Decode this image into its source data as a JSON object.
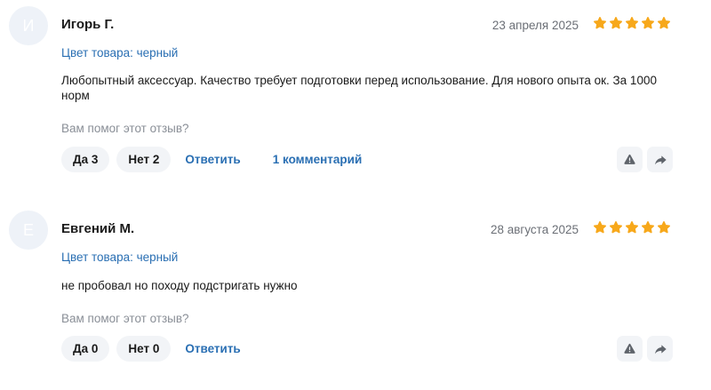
{
  "helpful_question": "Вам помог этот отзыв?",
  "reply_label": "Ответить",
  "colors": {
    "link": "#2a6fb3",
    "star": "#f7a81b",
    "pill_bg": "#f2f4f7",
    "avatar_bg": "#eef2f8"
  },
  "reviews": [
    {
      "avatar_letter": "И",
      "author": "Игорь Г.",
      "date": "23 апреля 2025",
      "rating": 5,
      "product_color": "Цвет товара: черный",
      "text": "Любопытный аксессуар. Качество требует подготовки перед использование. Для нового опыта ок. За 1000 норм",
      "yes_label": "Да 3",
      "no_label": "Нет 2",
      "comments_label": "1 комментарий"
    },
    {
      "avatar_letter": "Е",
      "author": "Евгений М.",
      "date": "28 августа 2025",
      "rating": 5,
      "product_color": "Цвет товара: черный",
      "text": "не пробовал но походу подстригать нужно",
      "yes_label": "Да 0",
      "no_label": "Нет 0"
    }
  ]
}
